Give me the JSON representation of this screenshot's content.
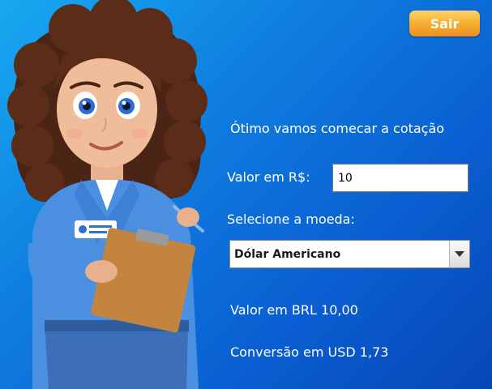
{
  "header": {
    "exit_label": "Sair"
  },
  "main": {
    "greeting": "Ótimo vamos comecar a cotação",
    "value_label": "Valor em R$:",
    "value_input": "10",
    "currency_label": "Selecione a moeda:",
    "currency_selected": "Dólar Americano",
    "result_brl": "Valor em BRL 10,00",
    "result_conversion": "Conversão em USD 1,73"
  },
  "colors": {
    "background_top": "#18a9f0",
    "background_bottom": "#0747b6",
    "button": "#f6b233"
  }
}
